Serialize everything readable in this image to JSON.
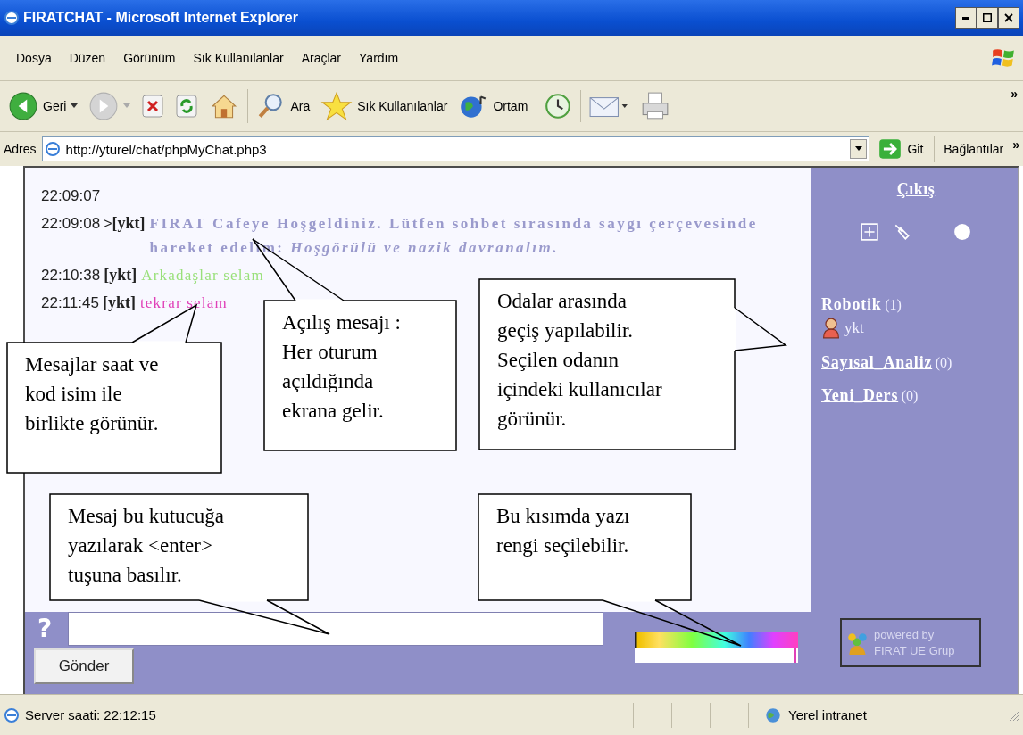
{
  "window": {
    "title": "FIRATCHAT - Microsoft Internet Explorer"
  },
  "menu": [
    "Dosya",
    "Düzen",
    "Görünüm",
    "Sık Kullanılanlar",
    "Araçlar",
    "Yardım"
  ],
  "toolbar": [
    {
      "kind": "back",
      "label": "Geri"
    },
    {
      "kind": "forward"
    },
    {
      "kind": "stop"
    },
    {
      "kind": "refresh"
    },
    {
      "kind": "home"
    },
    {
      "kind": "search",
      "label": "Ara"
    },
    {
      "kind": "favorites",
      "label": "Sık Kullanılanlar"
    },
    {
      "kind": "media",
      "label": "Ortam"
    },
    {
      "kind": "history"
    },
    {
      "kind": "mail"
    },
    {
      "kind": "print"
    }
  ],
  "toolbar_more": "»",
  "address": {
    "label": "Adres",
    "url": "http://yturel/chat/phpMyChat.php3",
    "go": "Git",
    "links": "Bağlantılar",
    "links_more": "»"
  },
  "chat": {
    "messages": [
      {
        "time": "22:09:07"
      },
      {
        "time": "22:09:08",
        "prefix": ">",
        "user": "[ykt]",
        "text": "FIRAT Cafeye Hoşgeldiniz. Lütfen sohbet sırasında saygı çerçevesinde hareket edelim: *Hoşgörülü ve nazik davranalım.*",
        "color": "#9a9acc"
      },
      {
        "time": "22:10:38",
        "user": "[ykt]",
        "text": "Arkadaşlar selam",
        "color": "#99e07a"
      },
      {
        "time": "22:11:45",
        "user": "[ykt]",
        "text": "tekrar selam",
        "color": "#e040b8"
      }
    ]
  },
  "sidebar": {
    "exit": "Çıkış",
    "rooms": [
      {
        "name": "Robotik",
        "count": "(1)",
        "selected": true,
        "users": [
          "ykt"
        ]
      },
      {
        "name": "Sayısal_Analiz",
        "count": "(0)",
        "selected": false
      },
      {
        "name": "Yeni_Ders",
        "count": "(0)",
        "selected": false
      }
    ]
  },
  "composer": {
    "help": "?",
    "send": "Gönder"
  },
  "badge": {
    "line1": "powered by",
    "line2": "FIRAT UE Grup"
  },
  "status_bar": {
    "text": "Server saati: 22:12:15",
    "zone": "Yerel intranet"
  },
  "callouts": [
    {
      "text": "Mesajlar saat ve\nkod isim ile\nbirlikte görünür."
    },
    {
      "text": "Açılış mesajı :\nHer oturum\naçıldığında\nekrana gelir."
    },
    {
      "text": "Odalar arasında\ngeçiş yapılabilir.\nSeçilen odanın\niçindeki kullanıcılar\ngörünür."
    },
    {
      "text": "Mesaj bu kutucuğa\nyazılarak <enter>\ntuşuna basılır."
    },
    {
      "text": "Bu kısımda yazı\nrengi seçilebilir."
    }
  ]
}
